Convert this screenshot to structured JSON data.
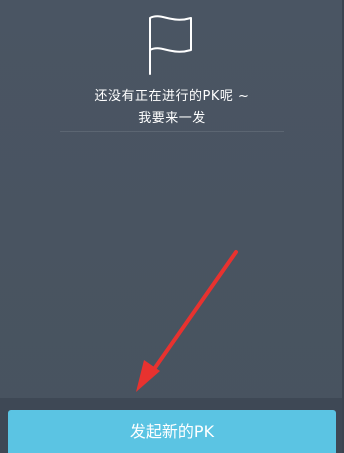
{
  "empty_state": {
    "icon": "flag-icon",
    "message_line1": "还没有正在进行的PK呢 ~",
    "message_line2": "我要来一发"
  },
  "actions": {
    "start_pk_label": "发起新的PK"
  },
  "colors": {
    "background": "#495462",
    "button": "#5bc4e3",
    "arrow": "#e8322f",
    "text": "#ffffff"
  }
}
